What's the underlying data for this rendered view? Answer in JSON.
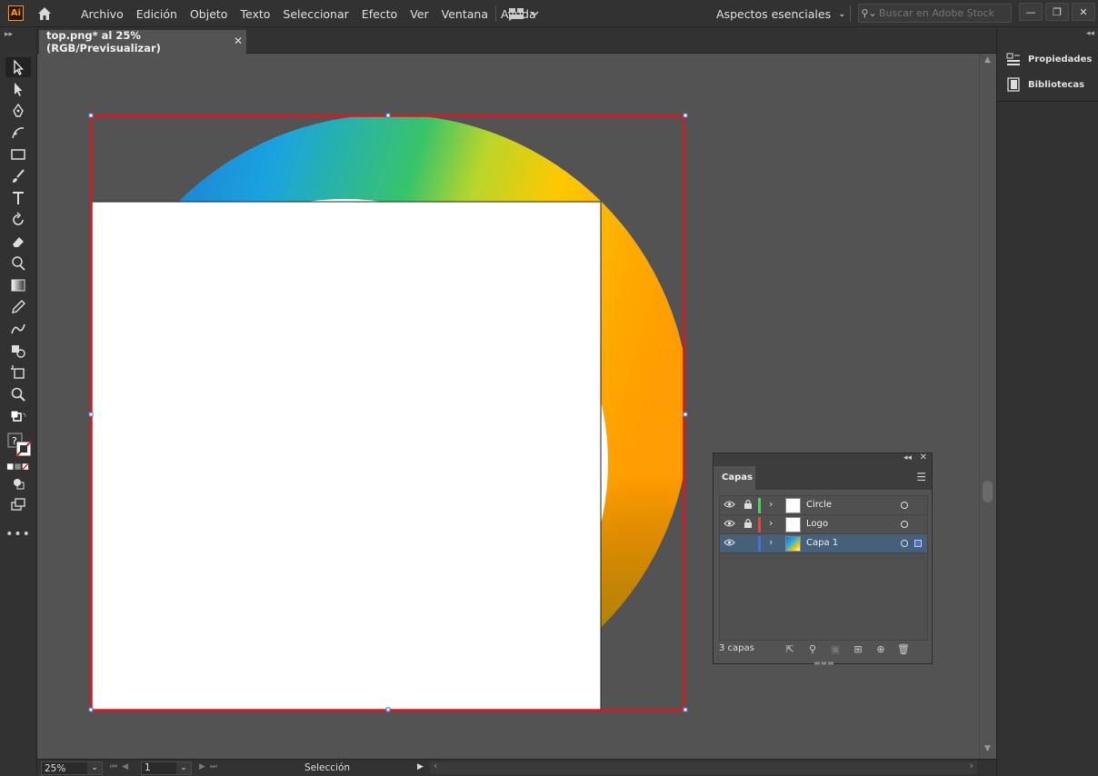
{
  "app": {
    "logo_text": "Ai",
    "menu": [
      "Archivo",
      "Edición",
      "Objeto",
      "Texto",
      "Seleccionar",
      "Efecto",
      "Ver",
      "Ventana",
      "Ayuda"
    ],
    "workspace": "Aspectos esenciales",
    "search_placeholder": "Buscar en Adobe Stock"
  },
  "document": {
    "tab_title": "top.png* al 25% (RGB/Previsualizar)",
    "close_glyph": "✕"
  },
  "status": {
    "zoom": "25%",
    "artboard": "1",
    "mode": "Selección"
  },
  "right_panel": {
    "items": [
      {
        "label": "Propiedades",
        "icon": "properties-icon"
      },
      {
        "label": "Bibliotecas",
        "icon": "libraries-icon"
      }
    ]
  },
  "layers_panel": {
    "tab": "Capas",
    "layers": [
      {
        "name": "Circle",
        "color": "#4fd35b",
        "locked": true,
        "selected": false
      },
      {
        "name": "Logo",
        "color": "#e04848",
        "locked": true,
        "selected": false
      },
      {
        "name": "Capa 1",
        "color": "#4a6fd6",
        "locked": false,
        "selected": true
      }
    ],
    "count": "3 capas"
  },
  "colors": {
    "artboard_border": "#e2141f",
    "canvas": "#535353",
    "chrome": "#323232"
  }
}
